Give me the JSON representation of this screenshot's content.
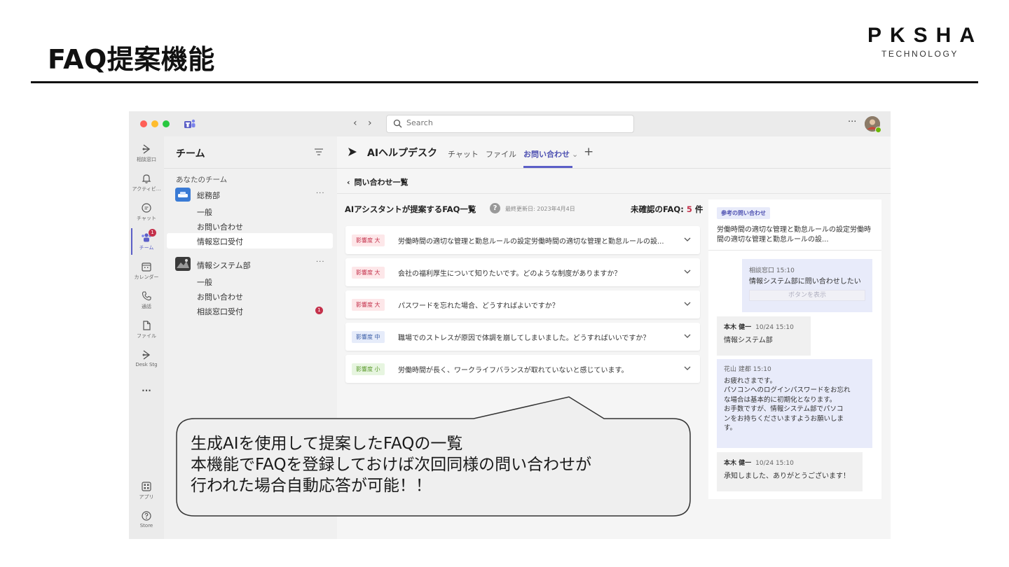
{
  "slide": {
    "title": "FAQ提案機能",
    "logo_main": "PKSHA",
    "logo_sub": "TECHNOLOGY"
  },
  "topbar": {
    "search_placeholder": "Search",
    "more": "···"
  },
  "rail": {
    "items": [
      {
        "icon": "help-desk-icon",
        "label": "相談窓口"
      },
      {
        "icon": "bell-icon",
        "label": "アクティビ..."
      },
      {
        "icon": "chat-icon",
        "label": "チャット"
      },
      {
        "icon": "teams-icon",
        "label": "チーム",
        "badge": "1",
        "active": true
      },
      {
        "icon": "calendar-icon",
        "label": "カレンダー"
      },
      {
        "icon": "phone-icon",
        "label": "通話"
      },
      {
        "icon": "file-icon",
        "label": "ファイル"
      },
      {
        "icon": "desk-stg-icon",
        "label": "Desk Stg"
      },
      {
        "icon": "more-apps-icon",
        "label": "···"
      },
      {
        "icon": "apps-icon",
        "label": "アプリ"
      },
      {
        "icon": "store-help-icon",
        "label": "Store"
      }
    ]
  },
  "teams_panel": {
    "title": "チーム",
    "section": "あなたのチーム",
    "teams": [
      {
        "name": "総務部",
        "more": "···",
        "channels": [
          "一般",
          "お問い合わせ",
          "情報窓口受付"
        ]
      },
      {
        "name": "情報システム部",
        "more": "···",
        "channels": [
          "一般",
          "お問い合わせ",
          "相談窓口受付"
        ],
        "badge": "1"
      }
    ]
  },
  "main": {
    "app_title": "AIヘルプデスク",
    "tabs": [
      {
        "label": "チャット",
        "active": false
      },
      {
        "label": "ファイル",
        "active": false
      },
      {
        "label": "お問い合わせ",
        "active": true,
        "chevron": "⌄"
      }
    ],
    "plus": "+",
    "back": "問い合わせ一覧",
    "list_title": "AIアシスタントが提案するFAQ一覧",
    "help": "?",
    "updated": "最終更新日: 2023年4月4日",
    "unconfirmed_label": "未確認のFAQ:",
    "unconfirmed_count": "5",
    "unconfirmed_unit": "件",
    "faqs": [
      {
        "impact": "影響度 大",
        "level": "high",
        "question": "労働時間の適切な管理と勤怠ルールの設定労働時間の適切な管理と勤怠ルールの設..."
      },
      {
        "impact": "影響度 大",
        "level": "high",
        "question": "会社の福利厚生について知りたいです。どのような制度がありますか？"
      },
      {
        "impact": "影響度 大",
        "level": "high",
        "question": "パスワードを忘れた場合、どうすればよいですか？"
      },
      {
        "impact": "影響度 中",
        "level": "mid",
        "question": "職場でのストレスが原因で体調を崩してしまいました。どうすればいいですか？"
      },
      {
        "impact": "影響度 小",
        "level": "low",
        "question": "労働時間が長く、ワークライフバランスが取れていないと感じています。"
      }
    ]
  },
  "chat": {
    "ref_label": "参考の問い合わせ",
    "ref_text": "労働時間の適切な管理と勤怠ルールの設定労働時間の適切な管理と勤怠ルールの設...",
    "messages": [
      {
        "sender": "相談窓口",
        "time": "15:10",
        "text": "情報システム部に問い合わせしたい",
        "button": "ボタンを表示"
      },
      {
        "sender": "本木 健一",
        "time": "10/24 15:10",
        "text": "情報システム部"
      },
      {
        "sender": "花山 建都",
        "time": "15:10",
        "lines": [
          "お疲れさまです。",
          "パソコンへのログインパスワードをお忘れ",
          "な場合は基本的に初期化となります。",
          "お手数ですが、情報システム部でパソコ",
          "ンをお持ちくださいますようお願いしま",
          "す。"
        ]
      },
      {
        "sender": "本木 健一",
        "time": "10/24 15:10",
        "text": "承知しました、ありがとうございます！"
      }
    ]
  },
  "callout": {
    "lines": [
      "生成AIを使用して提案したFAQの一覧",
      "本機能でFAQを登録しておけば次回同様の問い合わせが",
      "行われた場合自動応答が可能！！"
    ]
  },
  "colors": {
    "accent": "#5b5fc7",
    "badge_red": "#c4314b",
    "impact_high": "#c4314b",
    "impact_mid": "#3d5fa8",
    "impact_low": "#5a9a2b"
  }
}
